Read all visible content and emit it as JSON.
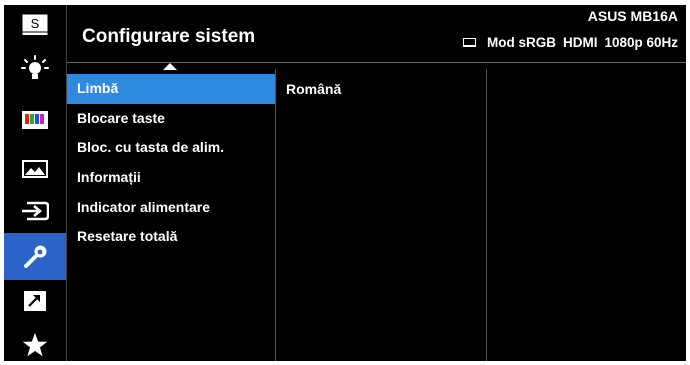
{
  "header": {
    "title": "Configurare sistem",
    "model": "ASUS MB16A",
    "status": {
      "mode": "Mod sRGB",
      "input": "HDMI",
      "resolution": "1080p 60Hz"
    }
  },
  "sidebar": {
    "items": [
      {
        "icon": "splendid-icon",
        "label": "S"
      },
      {
        "icon": "blue-light-filter-icon"
      },
      {
        "icon": "color-icon"
      },
      {
        "icon": "image-icon"
      },
      {
        "icon": "input-select-icon"
      },
      {
        "icon": "system-setup-icon",
        "active": true
      },
      {
        "icon": "shortcut-icon"
      },
      {
        "icon": "my-favorite-icon"
      }
    ]
  },
  "menu": {
    "items": [
      {
        "label": "Limbă",
        "selected": true
      },
      {
        "label": "Blocare taste"
      },
      {
        "label": "Bloc. cu tasta de alim."
      },
      {
        "label": "Informații"
      },
      {
        "label": "Indicator alimentare"
      },
      {
        "label": "Resetare totală"
      }
    ]
  },
  "submenu": {
    "value": "Română"
  },
  "colors": {
    "accent_active": "#2a64c8",
    "selected_row": "#2c8ae0",
    "background": "#000000"
  }
}
